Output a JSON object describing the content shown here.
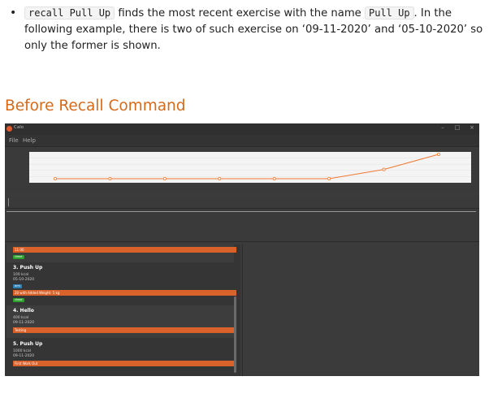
{
  "doc": {
    "bullet": "•",
    "code1": "recall Pull Up",
    "text1": " finds the most recent exercise with the name ",
    "code2": "Pull Up",
    "text2": ". In the following example, there is two of such exercise on ‘09-11-2020’ and ‘05-10-2020’ so only the former is shown.",
    "heading": "Before Recall Command"
  },
  "app": {
    "title": "Calo",
    "window_controls": [
      "–",
      "□",
      "×"
    ],
    "menu": [
      "File",
      "Help"
    ],
    "accent": "#d9622b",
    "list": [
      {
        "tag": "11:00",
        "chip": "chest"
      },
      {
        "title": "3. Push Up",
        "calories": "100 kcal",
        "date": "05-10-2020",
        "chip_blue": "arm",
        "tag": "20 with Added Weight: 5 kg",
        "chip": "chest"
      },
      {
        "title": "4. Hello",
        "calories": "400 kcal",
        "date": "09-11-2020",
        "tag": "Testing"
      },
      {
        "title": "5. Push Up",
        "calories": "1000 kcal",
        "date": "09-11-2020",
        "tag": "First Work Out"
      }
    ]
  },
  "chart_data": {
    "type": "line",
    "title": "",
    "xlabel": "",
    "ylabel": "",
    "line_color": "#f07a30",
    "values": [
      0,
      0,
      0,
      0,
      0,
      0,
      0.38,
      1.0
    ],
    "note": "unitless relative calorie level; axis tick labels too small to read"
  }
}
